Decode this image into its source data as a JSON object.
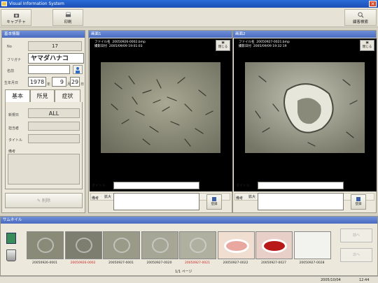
{
  "window": {
    "title": "Visual Information System"
  },
  "toolbar": {
    "capture": "キャプチャ",
    "print": "印刷",
    "search": "顧客検索"
  },
  "patient": {
    "header": "基本情報",
    "no_label": "No",
    "no": "17",
    "kana_label": "フリガナ",
    "kana": "ヤマダハナコ",
    "name_label": "名前",
    "birth_label": "生年月日",
    "year": "1978",
    "year_unit": "年",
    "month": "9",
    "month_unit": "月",
    "day": "29",
    "day_unit": "日",
    "tabs": [
      "基本",
      "所見",
      "症状"
    ],
    "reg_label": "新規日",
    "reg_value": "ALL",
    "staff_label": "担当者",
    "title_label": "タイトル",
    "notes_label": "備考",
    "delete": "削除"
  },
  "viewer1": {
    "header": "画面1",
    "file_label": "ファイル名",
    "file": "20050926-0002.bmp",
    "date_label": "撮影日付",
    "date": "2005/09/09 19:01:03",
    "close": "閉じる",
    "actions": [
      "拡大",
      "縮小",
      "保存",
      "詳細"
    ],
    "title_label": "タイトル",
    "notes_label": "備考",
    "save": "登録"
  },
  "viewer2": {
    "header": "画面2",
    "file_label": "ファイル名",
    "file": "20050927-0021.bmp",
    "date_label": "撮影日付",
    "date": "2005/09/09 19:32:19",
    "close": "閉じる",
    "actions": [
      "拡大",
      "縮小",
      "保存",
      "詳細"
    ],
    "title_label": "タイトル",
    "notes_label": "備考",
    "save": "登録"
  },
  "thumbnails": {
    "header": "サムネイル",
    "items": [
      {
        "caption": "20050926-0001",
        "color": "#222222"
      },
      {
        "caption": "20050926-0002",
        "color": "#cc2020"
      },
      {
        "caption": "20050927-0001",
        "color": "#222222"
      },
      {
        "caption": "20050927-0020",
        "color": "#222222"
      },
      {
        "caption": "20050927-0021",
        "color": "#cc2020"
      },
      {
        "caption": "20050927-0022",
        "color": "#222222"
      },
      {
        "caption": "20050927-0027",
        "color": "#222222"
      },
      {
        "caption": "20050927-0028",
        "color": "#222222"
      }
    ],
    "page": "1/1 ページ",
    "prev": "前へ",
    "next": "次へ"
  },
  "status": {
    "date": "2005/10/04",
    "time": "12:44"
  }
}
